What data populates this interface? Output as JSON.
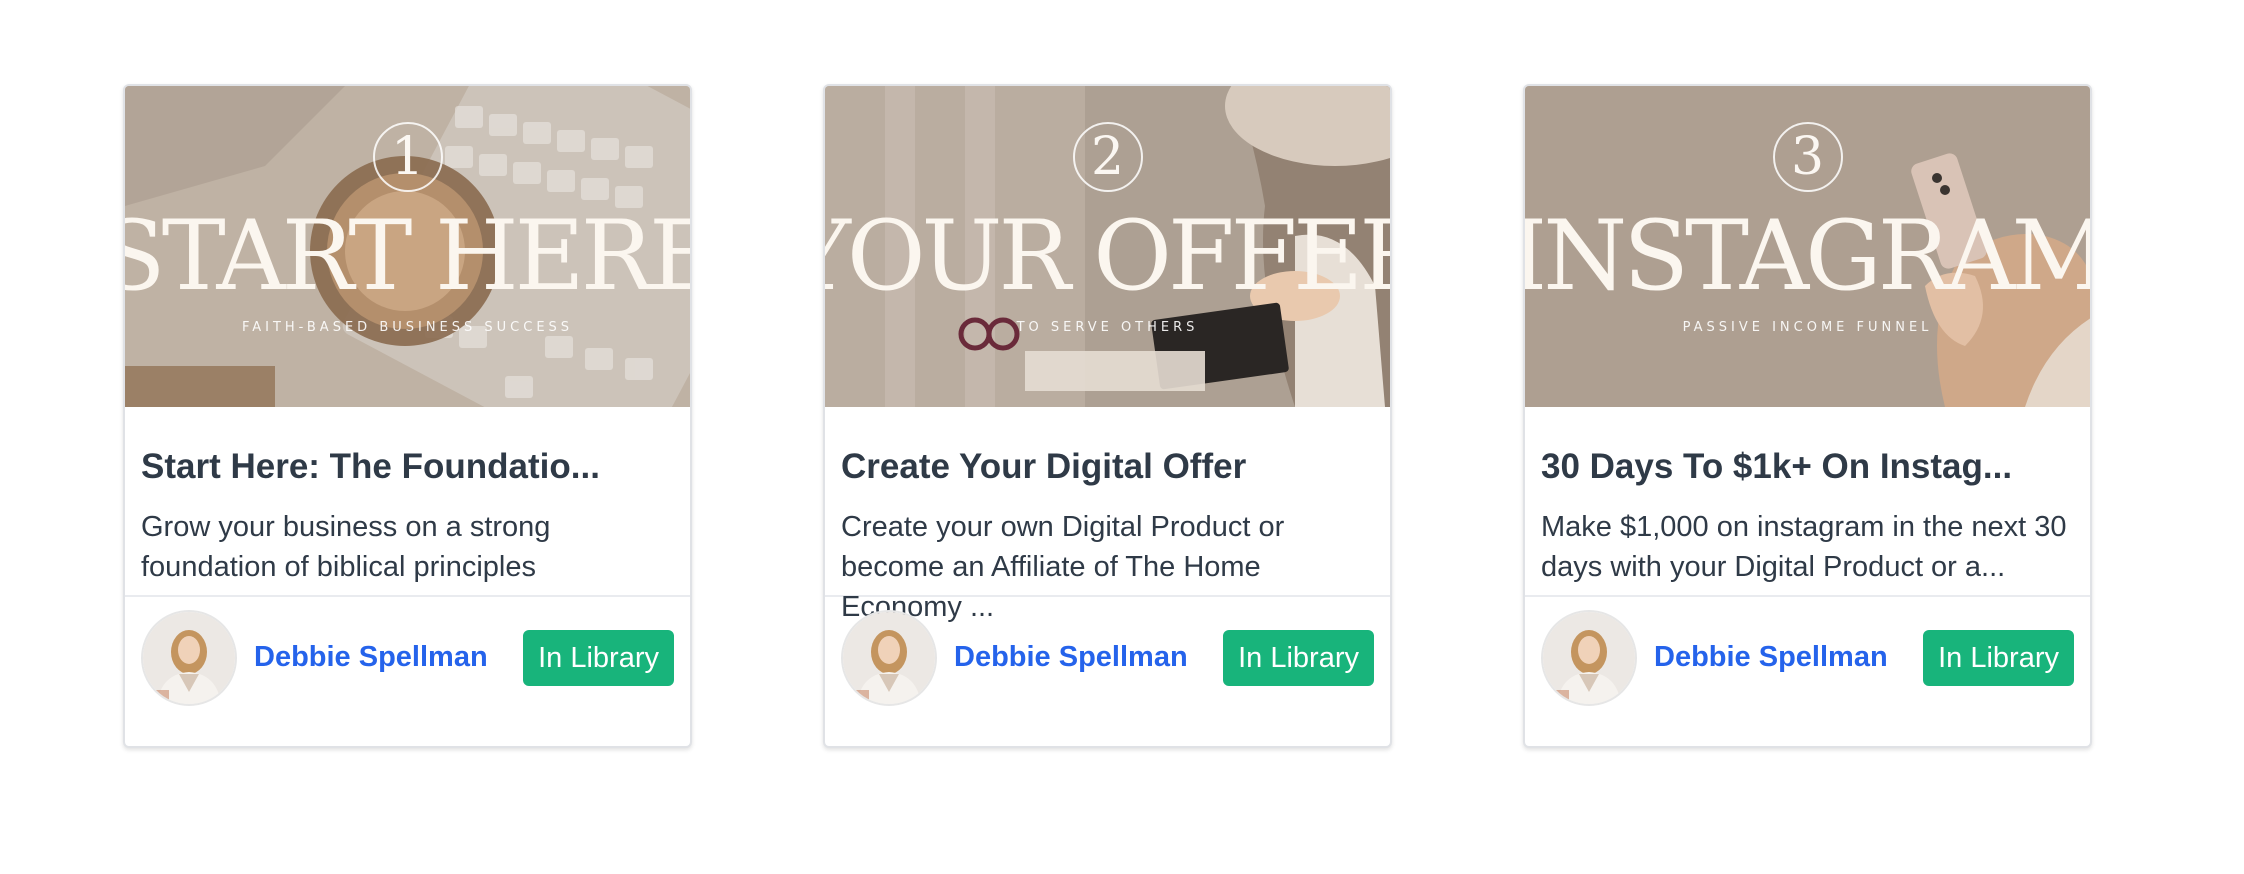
{
  "colors": {
    "accent_link": "#2563eb",
    "badge_bg": "#18b47b",
    "text": "#2f3a47",
    "thumb_tone": "#a9998a"
  },
  "courses": [
    {
      "thumb_number": "1",
      "thumb_title": "START HERE",
      "thumb_subtitle": "FAITH-BASED BUSINESS SUCCESS",
      "title": "Start Here: The Foundatio...",
      "description": "Grow your business on a strong foundation of biblical principles",
      "author": "Debbie Spellman",
      "badge": "In Library"
    },
    {
      "thumb_number": "2",
      "thumb_title": "YOUR OFFER",
      "thumb_subtitle": "TO SERVE OTHERS",
      "title": "Create Your Digital Offer",
      "description": "Create your own Digital Product or become an Affiliate of The Home Economy ...",
      "author": "Debbie Spellman",
      "badge": "In Library"
    },
    {
      "thumb_number": "3",
      "thumb_title": "INSTAGRAM",
      "thumb_subtitle": "PASSIVE INCOME FUNNEL",
      "title": "30 Days To $1k+ On Instag...",
      "description": "Make $1,000 on instagram in the next 30 days with your Digital Product or a...",
      "author": "Debbie Spellman",
      "badge": "In Library"
    }
  ]
}
